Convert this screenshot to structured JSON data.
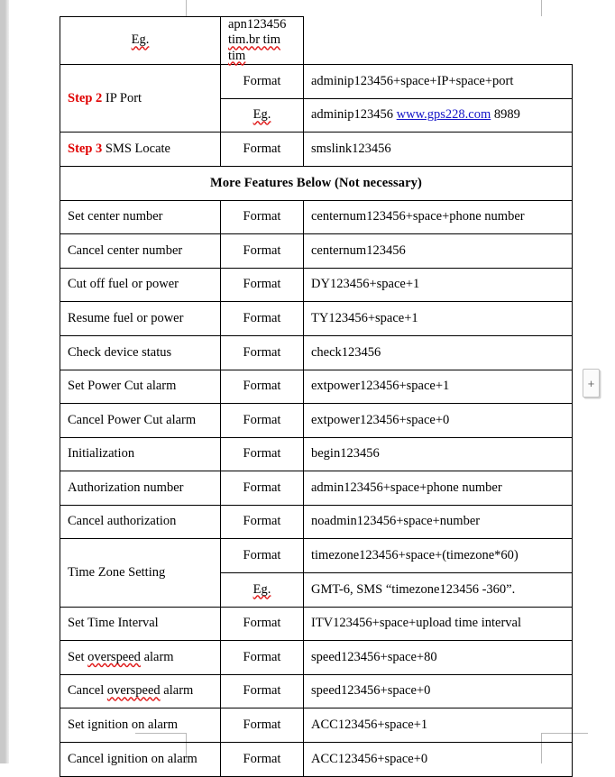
{
  "document": {
    "type": "word-processor-table",
    "insert_handle_label": "+"
  },
  "colors": {
    "step_accent": "#e00000",
    "hyperlink": "#1414c8",
    "spellcheck_underline": "#e11b1b",
    "table_border": "#000000",
    "page_background": "#ffffff",
    "gutter": "#c9c9c9"
  },
  "section_header": {
    "text": "More Features Below (Not necessary)"
  },
  "rows": [
    {
      "label": "",
      "label_step": "",
      "kind": "Eg.",
      "kind_spellcheck": true,
      "value_parts": [
        {
          "text": "apn123456 ",
          "style": "plain"
        },
        {
          "text": "tim.br tim tim",
          "style": "spellcheck"
        }
      ],
      "value_plain": "apn123456 tim.br tim tim",
      "label_rowspan": 0
    },
    {
      "label": " IP Port",
      "label_step": "Step 2",
      "kind": "Format",
      "kind_spellcheck": false,
      "value_parts": [
        {
          "text": "adminip123456+space+IP+space+port",
          "style": "plain"
        }
      ],
      "value_plain": "adminip123456+space+IP+space+port",
      "label_rowspan": 2
    },
    {
      "label": "",
      "label_step": "",
      "kind": "Eg.",
      "kind_spellcheck": true,
      "value_parts": [
        {
          "text": "adminip123456 ",
          "style": "plain"
        },
        {
          "text": "www.gps228.com",
          "style": "link"
        },
        {
          "text": " 8989",
          "style": "plain"
        }
      ],
      "value_plain": "adminip123456 www.gps228.com 8989",
      "label_rowspan": 0
    },
    {
      "label": " SMS Locate",
      "label_step": "Step 3",
      "kind": "Format",
      "kind_spellcheck": false,
      "value_parts": [
        {
          "text": "smslink123456",
          "style": "plain"
        }
      ],
      "value_plain": "smslink123456",
      "label_rowspan": 1
    }
  ],
  "feature_rows": [
    {
      "label": "Set center number",
      "label_spellcheck": false,
      "kind": "Format",
      "kind_spellcheck": false,
      "value": "centernum123456+space+phone number",
      "label_rowspan": 1
    },
    {
      "label": "Cancel center number",
      "label_spellcheck": false,
      "kind": "Format",
      "kind_spellcheck": false,
      "value": "centernum123456",
      "label_rowspan": 1
    },
    {
      "label": "Cut off fuel or power",
      "label_spellcheck": false,
      "kind": "Format",
      "kind_spellcheck": false,
      "value": "DY123456+space+1",
      "label_rowspan": 1
    },
    {
      "label": "Resume fuel or power",
      "label_spellcheck": false,
      "kind": "Format",
      "kind_spellcheck": false,
      "value": "TY123456+space+1",
      "label_rowspan": 1
    },
    {
      "label": "Check device status",
      "label_spellcheck": false,
      "kind": "Format",
      "kind_spellcheck": false,
      "value": "check123456",
      "label_rowspan": 1
    },
    {
      "label": "Set Power Cut alarm",
      "label_spellcheck": false,
      "kind": "Format",
      "kind_spellcheck": false,
      "value": "extpower123456+space+1",
      "label_rowspan": 1
    },
    {
      "label": "Cancel Power Cut alarm",
      "label_spellcheck": false,
      "kind": "Format",
      "kind_spellcheck": false,
      "value": "extpower123456+space+0",
      "label_rowspan": 1
    },
    {
      "label": "Initialization",
      "label_spellcheck": false,
      "kind": "Format",
      "kind_spellcheck": false,
      "value": "begin123456",
      "label_rowspan": 1
    },
    {
      "label": "Authorization number",
      "label_spellcheck": false,
      "kind": "Format",
      "kind_spellcheck": false,
      "value": "admin123456+space+phone number",
      "label_rowspan": 1
    },
    {
      "label": "Cancel authorization",
      "label_spellcheck": false,
      "kind": "Format",
      "kind_spellcheck": false,
      "value": "noadmin123456+space+number",
      "label_rowspan": 1
    },
    {
      "label": "Time Zone Setting",
      "label_spellcheck": false,
      "kind": "Format",
      "kind_spellcheck": false,
      "value": "timezone123456+space+(timezone*60)",
      "label_rowspan": 2
    },
    {
      "label": "",
      "label_spellcheck": false,
      "kind": "Eg.",
      "kind_spellcheck": true,
      "value": "GMT-6, SMS “timezone123456 -360”.",
      "label_rowspan": 0
    },
    {
      "label": "Set Time Interval",
      "label_spellcheck": false,
      "kind": "Format",
      "kind_spellcheck": false,
      "value": "ITV123456+space+upload time interval",
      "label_rowspan": 1
    },
    {
      "label": "Set overspeed alarm",
      "label_spellcheck": true,
      "label_spell_word": "overspeed",
      "kind": "Format",
      "kind_spellcheck": false,
      "value": "speed123456+space+80",
      "label_rowspan": 1
    },
    {
      "label": "Cancel overspeed alarm",
      "label_spellcheck": true,
      "label_spell_word": "overspeed",
      "kind": "Format",
      "kind_spellcheck": false,
      "value": "speed123456+space+0",
      "label_rowspan": 1
    },
    {
      "label": "Set ignition on alarm",
      "label_spellcheck": false,
      "kind": "Format",
      "kind_spellcheck": false,
      "value": "ACC123456+space+1",
      "label_rowspan": 1
    },
    {
      "label": "Cancel ignition on alarm",
      "label_spellcheck": false,
      "kind": "Format",
      "kind_spellcheck": false,
      "value": "ACC123456+space+0",
      "label_rowspan": 1
    }
  ]
}
